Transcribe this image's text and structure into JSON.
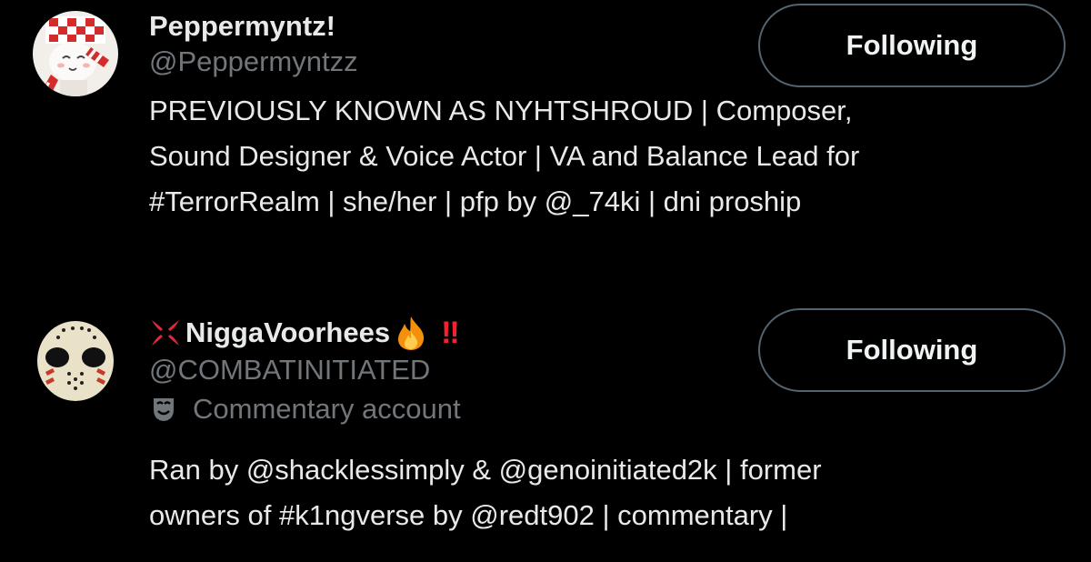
{
  "users": [
    {
      "display_name": "Peppermyntz!",
      "handle": "@Peppermyntzz",
      "follow_label": "Following",
      "bio": "PREVIOUSLY KNOWN AS NYHTSHROUD | Composer,\nSound Designer & Voice Actor | VA and Balance Lead for\n#TerrorRealm | she/her | pfp by @_74ki | dni proship",
      "avatar_icon": "peppermint-character-avatar"
    },
    {
      "display_name_prefix_icon": "anger-symbol-icon",
      "display_name": "NiggaVoorhees",
      "display_name_suffix_icons": [
        "fire-icon",
        "double-exclamation-icon"
      ],
      "double_exclamation": "‼",
      "handle": "@COMBATINITIATED",
      "label_icon": "theater-masks-icon",
      "label": "Commentary account",
      "follow_label": "Following",
      "bio": "Ran by @shacklessimply & @genoinitiated2k | former\nowners of #k1ngverse by @redt902 | commentary |",
      "avatar_icon": "hockey-mask-avatar"
    }
  ],
  "colors": {
    "background": "#000000",
    "primary_text": "#e7e9ea",
    "secondary_text": "#71767b",
    "button_border": "#536471",
    "accent_red": "#f4212e"
  }
}
